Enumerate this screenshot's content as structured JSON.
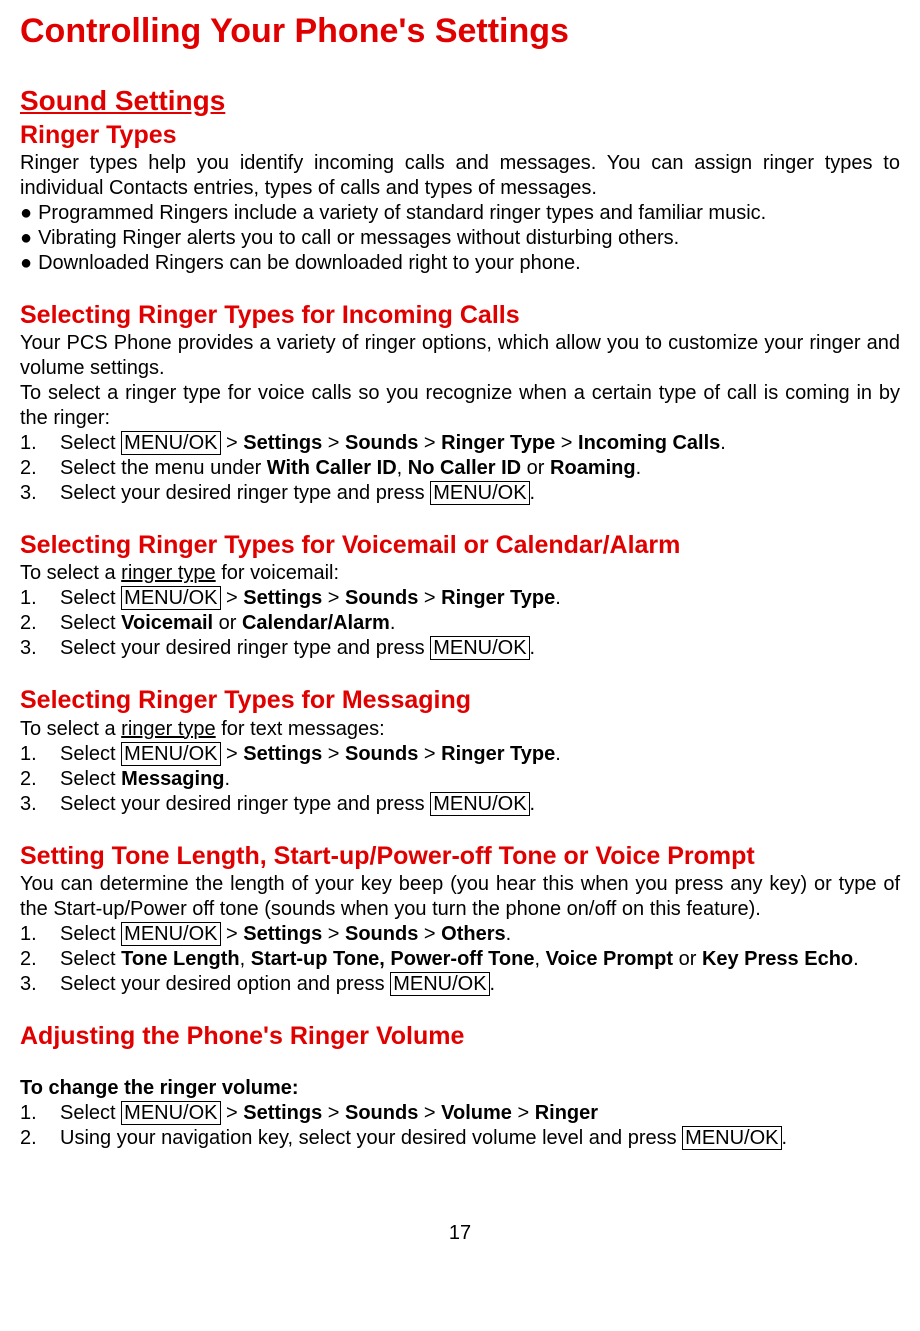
{
  "title": "Controlling Your Phone's Settings",
  "soundSettings": "Sound Settings",
  "ringerTypes": {
    "heading": "Ringer Types",
    "intro": "Ringer types help you identify incoming calls and messages. You can assign ringer types to individual Contacts entries, types of calls and types of messages.",
    "bullets": [
      "Programmed Ringers include a variety of standard ringer types and familiar music.",
      "Vibrating Ringer alerts you to call or messages without disturbing others.",
      "  Downloaded Ringers can be downloaded right to your phone."
    ]
  },
  "incomingCalls": {
    "heading": "Selecting Ringer Types for Incoming Calls",
    "p1": "Your PCS Phone provides a variety of ringer options, which allow you to customize your ringer and volume settings.",
    "p2": "To select a ringer type for voice calls so you recognize when a certain type of call is coming in by the ringer:",
    "num1": "1.",
    "num2": "2.",
    "num3": "3.",
    "step1_a": "Select ",
    "step1_box": "MENU/OK",
    "step1_b": " > ",
    "step1_settings": "Settings",
    "step1_c": " > ",
    "step1_sounds": "Sounds",
    "step1_d": " > ",
    "step1_ringertype": "Ringer Type",
    "step1_e": " > ",
    "step1_incoming": "Incoming Calls",
    "step1_f": ".",
    "step2_a": "Select the menu under ",
    "step2_with": "With Caller ID",
    "step2_b": ", ",
    "step2_no": "No Caller ID",
    "step2_c": " or ",
    "step2_roam": "Roaming",
    "step2_d": ".",
    "step3_a": "Select your desired ringer type and press ",
    "step3_box": "MENU/OK",
    "step3_b": "."
  },
  "voicemail": {
    "heading": "Selecting Ringer Types for Voicemail or Calendar/Alarm",
    "intro_a": "To select a ",
    "intro_ul": "ringer type",
    "intro_b": " for voicemail:",
    "num1": "1.",
    "num2": "2.",
    "num3": "3.",
    "step1_a": "Select ",
    "step1_box": "MENU/OK",
    "step1_b": " > ",
    "step1_settings": "Settings",
    "step1_c": " > ",
    "step1_sounds": "Sounds",
    "step1_d": " > ",
    "step1_ringertype": "Ringer Type",
    "step1_e": ".",
    "step2_a": "Select ",
    "step2_vm": "Voicemail",
    "step2_b": " or ",
    "step2_cal": "Calendar/Alarm",
    "step2_c": ".",
    "step3_a": "Select your desired ringer type and press ",
    "step3_box": "MENU/OK",
    "step3_b": "."
  },
  "messaging": {
    "heading": "Selecting Ringer Types for Messaging",
    "intro_a": "To select a ",
    "intro_ul": "ringer type",
    "intro_b": " for text messages:",
    "num1": "1.",
    "num2": "2.",
    "num3": "3.",
    "step1_a": "Select ",
    "step1_box": "MENU/OK",
    "step1_b": " > ",
    "step1_settings": "Settings",
    "step1_c": " > ",
    "step1_sounds": "Sounds",
    "step1_d": " > ",
    "step1_ringertype": "Ringer Type",
    "step1_e": ".",
    "step2_a": "Select ",
    "step2_msg": "Messaging",
    "step2_b": ".",
    "step3_a": "Select your desired ringer type and press ",
    "step3_box": "MENU/OK",
    "step3_b": "."
  },
  "tone": {
    "heading": "Setting Tone Length, Start-up/Power-off Tone or Voice Prompt",
    "intro": "You can determine the length of your key beep (you hear this when you press any key) or type of the Start-up/Power off tone (sounds when you turn the phone on/off on this feature).",
    "num1": "1.",
    "num2": "2.",
    "num3": "3.",
    "step1_a": "Select ",
    "step1_box": "MENU/OK",
    "step1_b": " > ",
    "step1_settings": "Settings",
    "step1_c": " > ",
    "step1_sounds": "Sounds",
    "step1_d": " > ",
    "step1_others": "Others",
    "step1_e": ".",
    "step2_a": "Select ",
    "step2_tl": "Tone Length",
    "step2_b": ", ",
    "step2_su": "Start-up Tone, Power-off Tone",
    "step2_c": ", ",
    "step2_vp": "Voice Prompt",
    "step2_d": " or ",
    "step2_kpe": "Key Press Echo",
    "step2_e": ".",
    "step3_a": "Select your desired option and press ",
    "step3_box": "MENU/OK",
    "step3_b": "."
  },
  "volume": {
    "heading": "Adjusting the Phone's Ringer Volume",
    "sub": "To change the ringer volume:",
    "num1": "1.",
    "num2": "2.",
    "step1_a": "Select ",
    "step1_box": "MENU/OK",
    "step1_b": " > ",
    "step1_settings": "Settings",
    "step1_c": " > ",
    "step1_sounds": "Sounds",
    "step1_d": " > ",
    "step1_volume": "Volume",
    "step1_e": " > ",
    "step1_ringer": "Ringer",
    "step2_a": "Using your navigation key, select your desired volume level and press ",
    "step2_box": "MENU/OK",
    "step2_b": "."
  },
  "pageNumber": "17"
}
